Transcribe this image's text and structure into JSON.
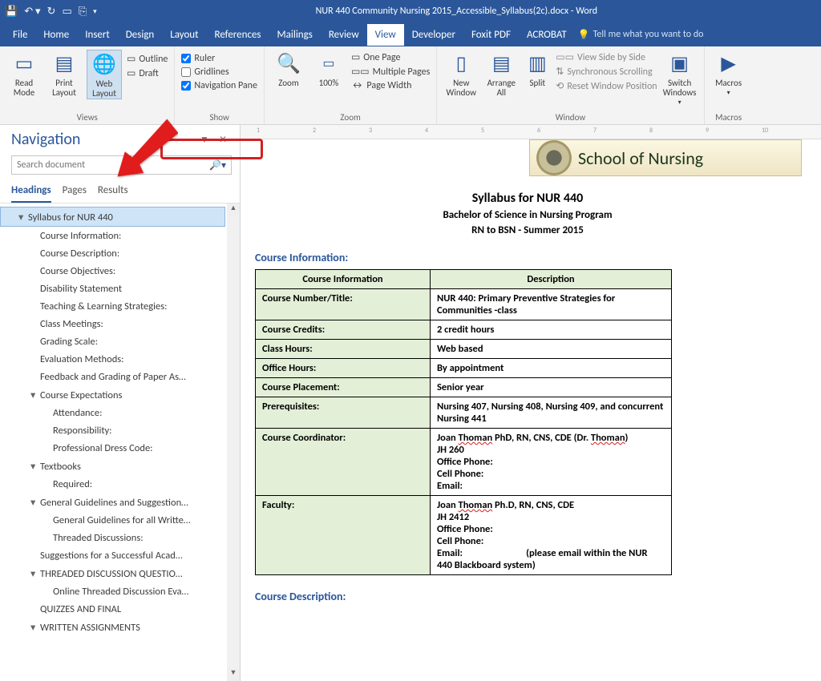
{
  "app": {
    "title": "NUR 440 Community Nursing 2015_Accessible_Syllabus(2c).docx - Word"
  },
  "tabs": {
    "file": "File",
    "home": "Home",
    "insert": "Insert",
    "design": "Design",
    "layout": "Layout",
    "references": "References",
    "mailings": "Mailings",
    "review": "Review",
    "view": "View",
    "developer": "Developer",
    "foxit": "Foxit PDF",
    "acrobat": "ACROBAT",
    "tellme": "Tell me what you want to do"
  },
  "ribbon": {
    "views": {
      "label": "Views",
      "read": "Read Mode",
      "print": "Print Layout",
      "web": "Web Layout",
      "outline": "Outline",
      "draft": "Draft"
    },
    "show": {
      "label": "Show",
      "ruler": "Ruler",
      "gridlines": "Gridlines",
      "nav": "Navigation Pane"
    },
    "zoom": {
      "label": "Zoom",
      "zoom": "Zoom",
      "p100": "100%",
      "one": "One Page",
      "multi": "Multiple Pages",
      "pagew": "Page Width"
    },
    "window": {
      "label": "Window",
      "neww": "New Window",
      "arrange": "Arrange All",
      "split": "Split",
      "side": "View Side by Side",
      "sync": "Synchronous Scrolling",
      "reset": "Reset Window Position",
      "switch": "Switch Windows"
    },
    "macros": {
      "label": "Macros",
      "macros": "Macros"
    }
  },
  "nav": {
    "title": "Navigation",
    "search_placeholder": "Search document",
    "tabs": {
      "headings": "Headings",
      "pages": "Pages",
      "results": "Results"
    },
    "items": [
      {
        "lvl": 0,
        "caret": "▾",
        "label": "Syllabus for NUR 440",
        "sel": true
      },
      {
        "lvl": 1,
        "label": "Course Information:"
      },
      {
        "lvl": 1,
        "label": "Course Description:"
      },
      {
        "lvl": 1,
        "label": "Course Objectives:"
      },
      {
        "lvl": 1,
        "label": "Disability Statement"
      },
      {
        "lvl": 1,
        "label": "Teaching & Learning Strategies:"
      },
      {
        "lvl": 1,
        "label": "Class Meetings:"
      },
      {
        "lvl": 1,
        "label": "Grading Scale:"
      },
      {
        "lvl": 1,
        "label": "Evaluation Methods:"
      },
      {
        "lvl": 1,
        "label": "Feedback and Grading of Paper As…"
      },
      {
        "lvl": 1,
        "caret": "▾",
        "label": "Course Expectations"
      },
      {
        "lvl": 2,
        "label": "Attendance:"
      },
      {
        "lvl": 2,
        "label": "Responsibility:"
      },
      {
        "lvl": 2,
        "label": "Professional Dress Code:"
      },
      {
        "lvl": 1,
        "caret": "▾",
        "label": "Textbooks"
      },
      {
        "lvl": 2,
        "label": "Required:"
      },
      {
        "lvl": 1,
        "caret": "▾",
        "label": "General Guidelines and Suggestion…"
      },
      {
        "lvl": 2,
        "label": "General Guidelines for all Writte…"
      },
      {
        "lvl": 2,
        "label": "Threaded Discussions:"
      },
      {
        "lvl": 1,
        "label": "Suggestions for a Successful Acad…"
      },
      {
        "lvl": 1,
        "caret": "▾",
        "label": "THREADED DISCUSSION QUESTIO…"
      },
      {
        "lvl": 2,
        "label": "Online Threaded Discussion Eva…"
      },
      {
        "lvl": 1,
        "label": "QUIZZES AND FINAL"
      },
      {
        "lvl": 1,
        "caret": "▾",
        "label": "WRITTEN ASSIGNMENTS"
      }
    ]
  },
  "doc": {
    "banner": "School of Nursing",
    "t1": "Syllabus for NUR 440",
    "t2": "Bachelor of Science in Nursing Program",
    "t3": "RN to BSN  -  Summer 2015",
    "sect_info": "Course Information:",
    "sect_desc": "Course Description:",
    "th_a": "Course Information",
    "th_b": "Description",
    "rows": [
      {
        "a": "Course Number/Title:",
        "b": "NUR 440: Primary Preventive Strategies for Communities -class"
      },
      {
        "a": "Course Credits:",
        "b": "2 credit hours"
      },
      {
        "a": "Class Hours:",
        "b": "Web based"
      },
      {
        "a": "Office Hours:",
        "b": "By appointment"
      },
      {
        "a": "Course Placement:",
        "b": "Senior year"
      },
      {
        "a": "Prerequisites:",
        "b": "Nursing 407, Nursing 408, Nursing 409, and concurrent Nursing 441"
      },
      {
        "a": "Course Coordinator:",
        "b": "Joan Thoman PhD, RN, CNS, CDE (Dr. Thoman)<br>JH 260<br>Office Phone:<br>Cell Phone:<br>Email:"
      },
      {
        "a": "Faculty:",
        "b": "Joan Thoman Ph.D, RN, CNS, CDE<br>JH 2412<br>Office Phone:<br>Cell Phone:<br>Email: &nbsp;&nbsp;&nbsp;&nbsp;&nbsp;&nbsp;&nbsp;&nbsp;&nbsp;&nbsp;&nbsp;&nbsp;&nbsp;&nbsp;&nbsp;&nbsp;&nbsp;&nbsp;&nbsp;&nbsp;&nbsp;&nbsp;&nbsp;&nbsp;&nbsp;&nbsp;&nbsp;(please email within the NUR 440 Blackboard system)"
      }
    ]
  },
  "ruler_marks": [
    "1",
    "2",
    "3",
    "4",
    "5",
    "6",
    "7",
    "8",
    "9",
    "10"
  ]
}
